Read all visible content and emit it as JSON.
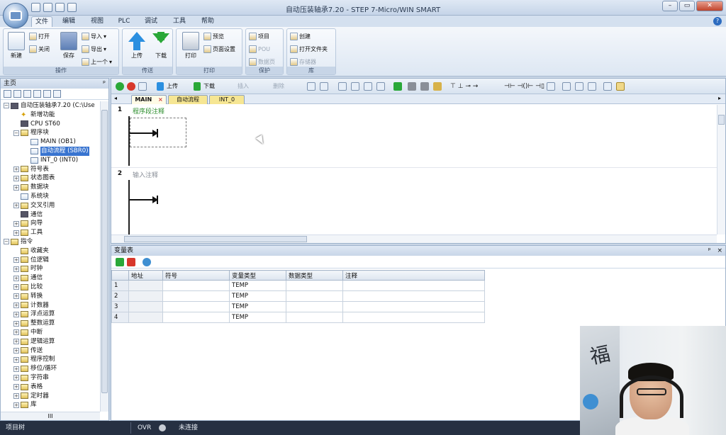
{
  "window": {
    "title": "自动压装轴承7.20 - STEP 7-Micro/WIN SMART"
  },
  "menu_tabs": [
    "文件",
    "编辑",
    "视图",
    "PLC",
    "调试",
    "工具",
    "帮助"
  ],
  "ribbon": {
    "groups": {
      "operation": "操作",
      "transfer": "传送",
      "print": "打印",
      "protect": "保护",
      "library": "库"
    },
    "new_label": "新建",
    "open_label": "打开",
    "close_label": "关闭",
    "save_label": "保存",
    "import_label": "导入",
    "export_label": "导出",
    "previous_label": "上一个",
    "upload_label": "上传",
    "download_label": "下载",
    "print_label": "打印",
    "preview_label": "预览",
    "page_setup_label": "页面设置",
    "project_label": "项目",
    "pou_label": "POU",
    "data_page_label": "数据页",
    "create_label": "创建",
    "open_folder_label": "打开文件夹",
    "memory_label": "存储器"
  },
  "left_panel": {
    "title": "主页",
    "pin": "ᵖ",
    "tree": [
      {
        "label": "自动压装轴承7.20 (C:\\Use",
        "level": 0,
        "exp": "−",
        "icon": "chip"
      },
      {
        "label": "新增功能",
        "level": 1,
        "exp": "",
        "icon": "star"
      },
      {
        "label": "CPU ST60",
        "level": 1,
        "exp": "",
        "icon": "chip"
      },
      {
        "label": "程序块",
        "level": 1,
        "exp": "−",
        "icon": "folder"
      },
      {
        "label": "MAIN (OB1)",
        "level": 2,
        "exp": "",
        "icon": "doc"
      },
      {
        "label": "自动流程 (SBR0)",
        "level": 2,
        "exp": "",
        "icon": "doc",
        "selected": true
      },
      {
        "label": "INT_0 (INT0)",
        "level": 2,
        "exp": "",
        "icon": "doc"
      },
      {
        "label": "符号表",
        "level": 1,
        "exp": "+",
        "icon": "folder"
      },
      {
        "label": "状态图表",
        "level": 1,
        "exp": "+",
        "icon": "folder"
      },
      {
        "label": "数据块",
        "level": 1,
        "exp": "+",
        "icon": "folder"
      },
      {
        "label": "系统块",
        "level": 1,
        "exp": "",
        "icon": "doc"
      },
      {
        "label": "交叉引用",
        "level": 1,
        "exp": "+",
        "icon": "folder"
      },
      {
        "label": "通信",
        "level": 1,
        "exp": "",
        "icon": "chip"
      },
      {
        "label": "向导",
        "level": 1,
        "exp": "+",
        "icon": "folder"
      },
      {
        "label": "工具",
        "level": 1,
        "exp": "+",
        "icon": "folder"
      },
      {
        "label": "指令",
        "level": 0,
        "exp": "−",
        "icon": "folder"
      },
      {
        "label": "收藏夹",
        "level": 1,
        "exp": "",
        "icon": "folder"
      },
      {
        "label": "位逻辑",
        "level": 1,
        "exp": "+",
        "icon": "folder"
      },
      {
        "label": "时钟",
        "level": 1,
        "exp": "+",
        "icon": "folder"
      },
      {
        "label": "通信",
        "level": 1,
        "exp": "+",
        "icon": "folder"
      },
      {
        "label": "比较",
        "level": 1,
        "exp": "+",
        "icon": "folder"
      },
      {
        "label": "转换",
        "level": 1,
        "exp": "+",
        "icon": "folder"
      },
      {
        "label": "计数器",
        "level": 1,
        "exp": "+",
        "icon": "folder"
      },
      {
        "label": "浮点运算",
        "level": 1,
        "exp": "+",
        "icon": "folder"
      },
      {
        "label": "整数运算",
        "level": 1,
        "exp": "+",
        "icon": "folder"
      },
      {
        "label": "中断",
        "level": 1,
        "exp": "+",
        "icon": "folder"
      },
      {
        "label": "逻辑运算",
        "level": 1,
        "exp": "+",
        "icon": "folder"
      },
      {
        "label": "传送",
        "level": 1,
        "exp": "+",
        "icon": "folder"
      },
      {
        "label": "程序控制",
        "level": 1,
        "exp": "+",
        "icon": "folder"
      },
      {
        "label": "移位/循环",
        "level": 1,
        "exp": "+",
        "icon": "folder"
      },
      {
        "label": "字符串",
        "level": 1,
        "exp": "+",
        "icon": "folder"
      },
      {
        "label": "表格",
        "level": 1,
        "exp": "+",
        "icon": "folder"
      },
      {
        "label": "定时器",
        "level": 1,
        "exp": "+",
        "icon": "folder"
      },
      {
        "label": "库",
        "level": 1,
        "exp": "+",
        "icon": "folder"
      }
    ],
    "hscroll_grip": "III"
  },
  "editor": {
    "toolbar_upload": "上传",
    "toolbar_download": "下载",
    "toolbar_insert": "插入",
    "toolbar_delete": "删除",
    "tabs": [
      {
        "label": "MAIN",
        "close": "×"
      },
      {
        "label": "自动流程",
        "close": ""
      },
      {
        "label": "INT_0",
        "close": ""
      }
    ],
    "networks": [
      {
        "number": "1",
        "comment": "程序段注释"
      },
      {
        "number": "2",
        "comment": "输入注释"
      }
    ]
  },
  "variable_table": {
    "title": "变量表",
    "pin": "ᵖ",
    "close": "×",
    "columns": [
      "",
      "地址",
      "符号",
      "变量类型",
      "数据类型",
      "注释"
    ],
    "rows": [
      {
        "n": "1",
        "addr": "",
        "symbol": "",
        "var_type": "TEMP",
        "data_type": "",
        "comment": ""
      },
      {
        "n": "2",
        "addr": "",
        "symbol": "",
        "var_type": "TEMP",
        "data_type": "",
        "comment": ""
      },
      {
        "n": "3",
        "addr": "",
        "symbol": "",
        "var_type": "TEMP",
        "data_type": "",
        "comment": ""
      },
      {
        "n": "4",
        "addr": "",
        "symbol": "",
        "var_type": "TEMP",
        "data_type": "",
        "comment": ""
      }
    ]
  },
  "statusbar": {
    "left": "项目树",
    "mode": "OVR",
    "connection": "未连接"
  },
  "colors": {
    "selection": "#3874d0",
    "comment_green": "#2f8f2f",
    "statusbar": "#263042"
  }
}
